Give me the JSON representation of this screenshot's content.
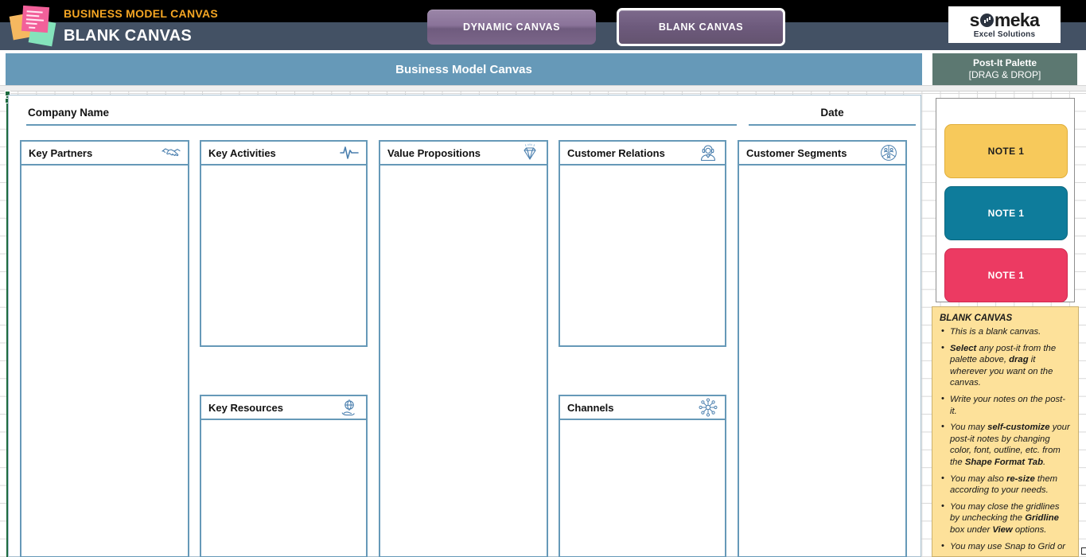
{
  "header": {
    "kicker": "BUSINESS MODEL CANVAS",
    "title": "BLANK CANVAS",
    "logo_icon": "post-it-stack-icon",
    "brand": {
      "word_a": "s",
      "word_b": "meka",
      "tagline": "Excel Solutions"
    }
  },
  "tabs": [
    {
      "label": "DYNAMIC CANVAS",
      "active": false
    },
    {
      "label": "BLANK CANVAS",
      "active": true
    }
  ],
  "banners": {
    "canvas_title": "Business Model Canvas",
    "palette_title": "Post-It Palette",
    "palette_sub": "[DRAG & DROP]"
  },
  "canvas": {
    "company_label": "Company Name",
    "date_label": "Date",
    "blocks": [
      {
        "title": "Key Partners",
        "icon": "handshake-icon"
      },
      {
        "title": "Key Activities",
        "icon": "pulse-line-icon"
      },
      {
        "title": "Value Propositions",
        "icon": "diamond-gem-icon"
      },
      {
        "title": "Customer Relations",
        "icon": "headset-agent-icon"
      },
      {
        "title": "Customer Segments",
        "icon": "segmented-people-circle-icon"
      },
      {
        "title": "Key Resources",
        "icon": "globe-on-hand-icon"
      },
      {
        "title": "Channels",
        "icon": "network-hub-icon"
      }
    ]
  },
  "palette": {
    "notes": [
      {
        "label": "NOTE 1",
        "color": "#f7c95b"
      },
      {
        "label": "NOTE 1",
        "color": "#0e7c9b"
      },
      {
        "label": "NOTE 1",
        "color": "#ec3a62"
      }
    ]
  },
  "instructions": {
    "title": "BLANK CANVAS",
    "items": [
      "This is a blank canvas.",
      "Select any post-it from the palette above, drag it wherever you want on the canvas.",
      "Write your notes on the post-it.",
      "You may self-customize your post-it notes by changing color, font, outline, etc. from the Shape Format Tab.",
      "You may also re-size them according to your needs.",
      "You may close the  gridlines by unchecking the Gridline box under View options.",
      "You may use Snap to Grid or"
    ]
  },
  "colors": {
    "amber": "#f5a623",
    "slate": "#435164",
    "steel_blue": "#6699b8",
    "palette_green": "#5c7871",
    "purple_tab": "#7d6a8c",
    "note_yellow": "#f7c95b",
    "note_teal": "#0e7c9b",
    "note_pink": "#ec3a62",
    "instruction_bg": "#fde19a"
  }
}
